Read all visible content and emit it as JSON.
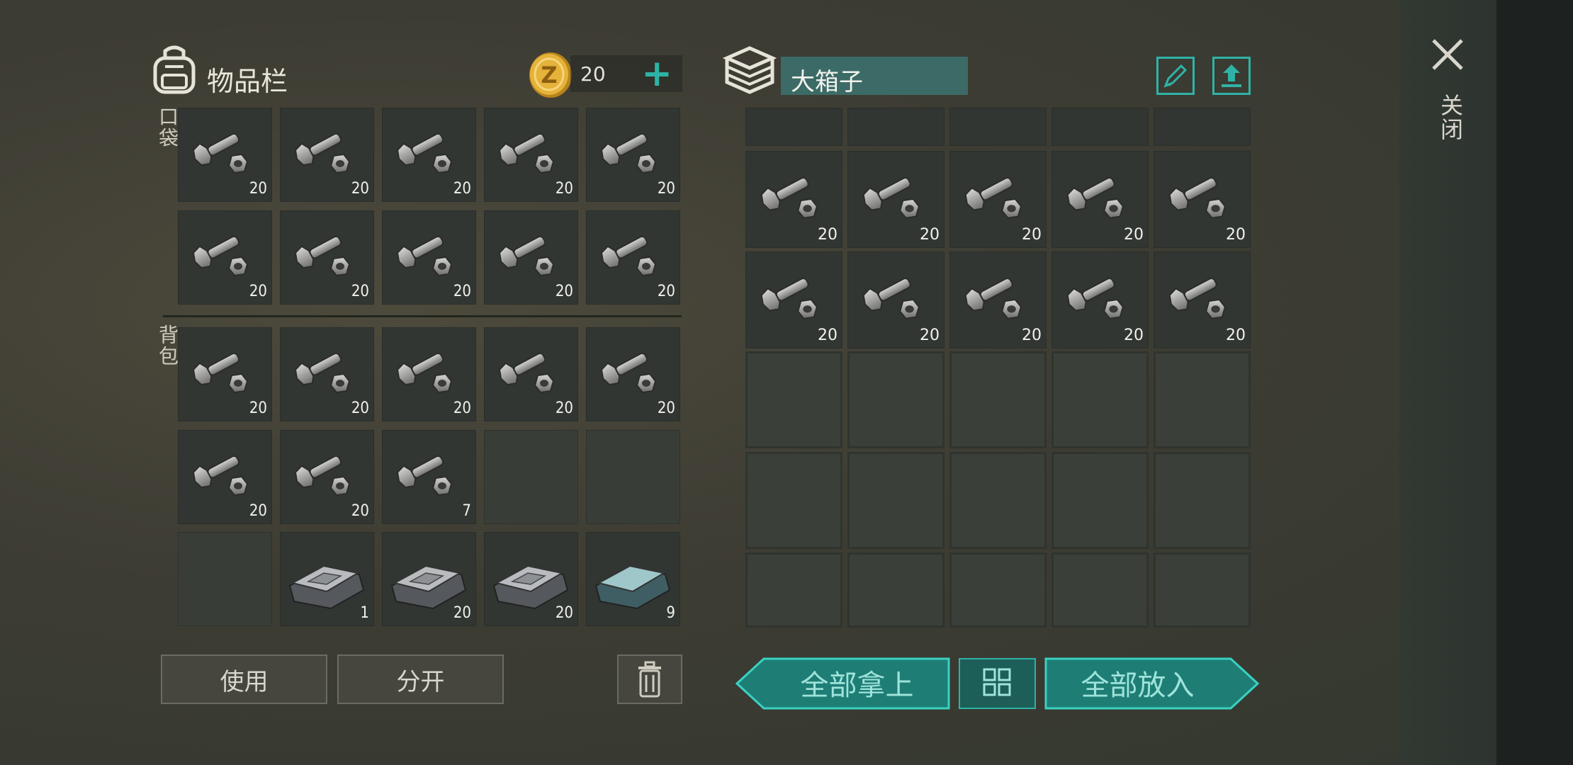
{
  "inventory": {
    "title": "物品栏",
    "coin_count": "20",
    "add_coins_symbol": "+",
    "section_pocket": "口袋",
    "section_backpack": "背包",
    "pocket_slots": [
      {
        "item": "bolt",
        "count": "20"
      },
      {
        "item": "bolt",
        "count": "20"
      },
      {
        "item": "bolt",
        "count": "20"
      },
      {
        "item": "bolt",
        "count": "20"
      },
      {
        "item": "bolt",
        "count": "20"
      },
      {
        "item": "bolt",
        "count": "20"
      },
      {
        "item": "bolt",
        "count": "20"
      },
      {
        "item": "bolt",
        "count": "20"
      },
      {
        "item": "bolt",
        "count": "20"
      },
      {
        "item": "bolt",
        "count": "20"
      }
    ],
    "backpack_slots": [
      {
        "item": "bolt",
        "count": "20"
      },
      {
        "item": "bolt",
        "count": "20"
      },
      {
        "item": "bolt",
        "count": "20"
      },
      {
        "item": "bolt",
        "count": "20"
      },
      {
        "item": "bolt",
        "count": "20"
      },
      {
        "item": "bolt",
        "count": "20"
      },
      {
        "item": "bolt",
        "count": "20"
      },
      {
        "item": "bolt",
        "count": "7"
      },
      {
        "item": "",
        "count": ""
      },
      {
        "item": "",
        "count": ""
      },
      {
        "item": "",
        "count": ""
      },
      {
        "item": "iron-ingot",
        "count": "1"
      },
      {
        "item": "iron-ingot",
        "count": "20"
      },
      {
        "item": "iron-ingot",
        "count": "20"
      },
      {
        "item": "steel-ingot",
        "count": "9"
      }
    ],
    "use_label": "使用",
    "split_label": "分开"
  },
  "storage": {
    "name": "大箱子",
    "slots": [
      {
        "item": "bolt",
        "count": "20"
      },
      {
        "item": "bolt",
        "count": "20"
      },
      {
        "item": "bolt",
        "count": "20"
      },
      {
        "item": "bolt",
        "count": "20"
      },
      {
        "item": "bolt",
        "count": "20"
      },
      {
        "item": "bolt",
        "count": "20"
      },
      {
        "item": "bolt",
        "count": "20"
      },
      {
        "item": "bolt",
        "count": "20"
      },
      {
        "item": "bolt",
        "count": "20"
      },
      {
        "item": "bolt",
        "count": "20"
      }
    ],
    "take_all_label": "全部拿上",
    "put_all_label": "全部放入"
  },
  "close_label": "关闭",
  "colors": {
    "teal": "#1f8f86",
    "teal_light": "#2fb3a7",
    "coin": "#e0a82a"
  }
}
